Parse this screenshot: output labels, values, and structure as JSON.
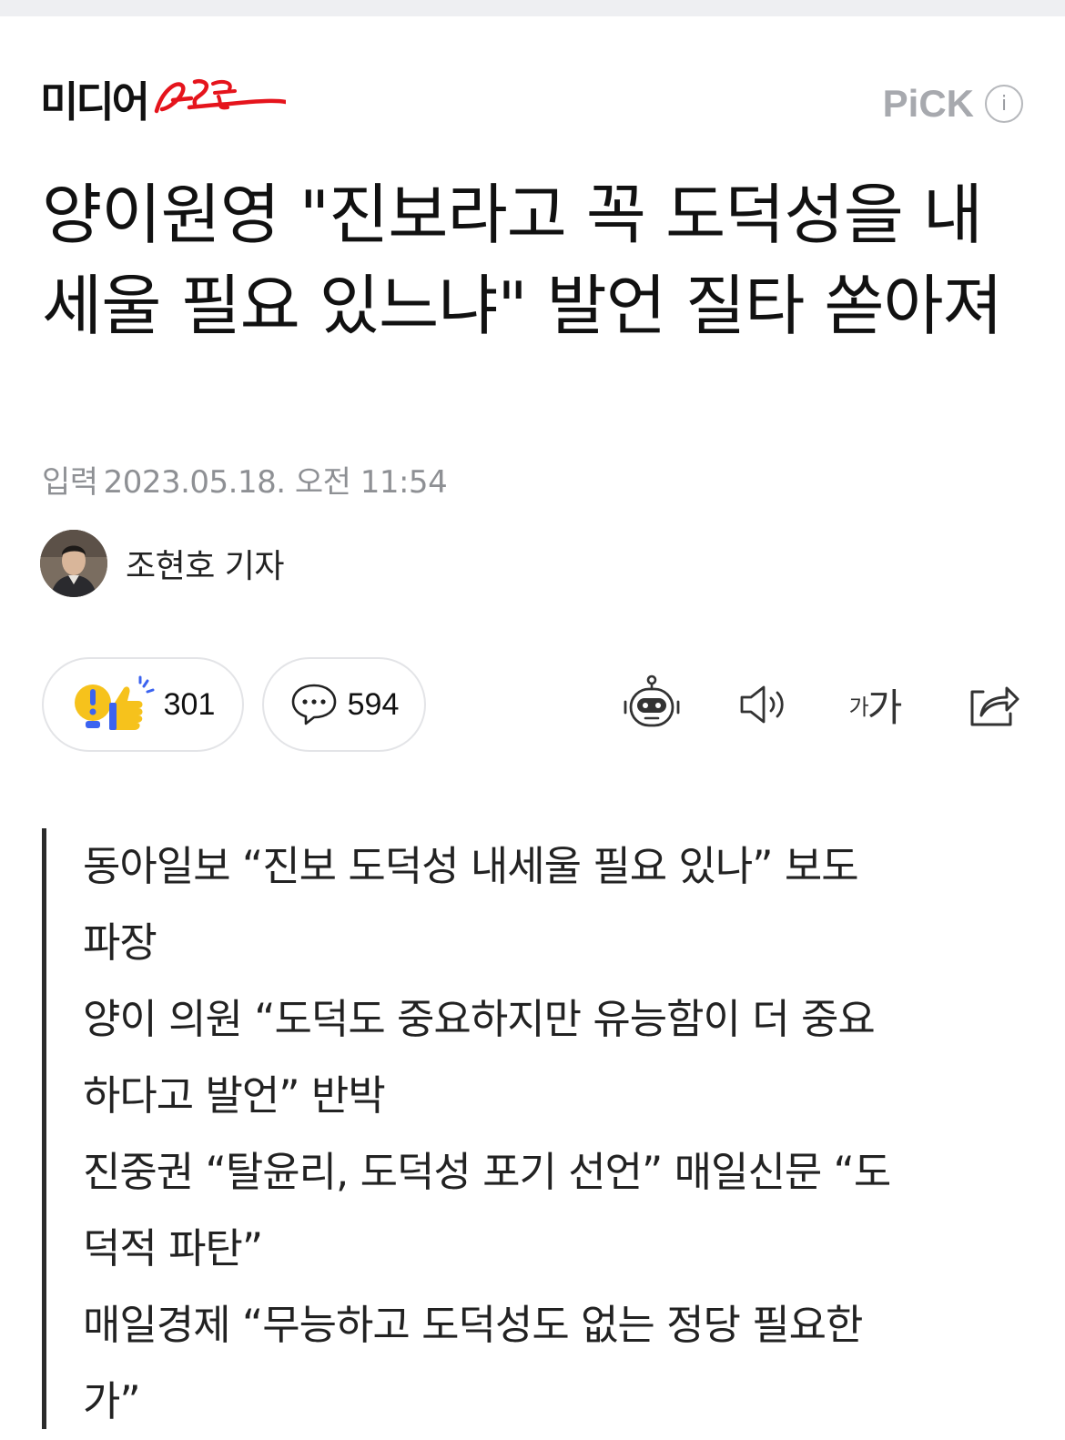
{
  "header": {
    "publisher": "미디어",
    "publisher_script": "오늘",
    "pick_label": "PiCK",
    "info_glyph": "i"
  },
  "article": {
    "headline": "양이원영 \"진보라고 꼭 도덕성을 내세울 필요 있느냐\" 발언 질타 쏟아져",
    "date_label": "입력",
    "date_value": "2023.05.18. 오전 11:54",
    "reporter": "조현호 기자"
  },
  "actions": {
    "reaction_count": "301",
    "comment_count": "594",
    "font_small": "가",
    "font_large": "가"
  },
  "icons": {
    "reaction": "reaction-emoji-icon",
    "comment": "comment-bubble-icon",
    "ai_summary": "robot-icon",
    "tts": "speaker-icon",
    "font_size": "font-size-icon",
    "share": "share-icon"
  },
  "colors": {
    "text": "#111111",
    "muted": "#8e9094",
    "pick_gray": "#a7a9ae",
    "logo_red": "#e5141c",
    "pill_border": "#e3e4e7",
    "reaction_yellow": "#f6c21c",
    "reaction_blue": "#3b63f0"
  },
  "summary": [
    "동아일보 “진보 도덕성 내세울 필요 있나” 보도",
    "파장",
    "양이 의원 “도덕도 중요하지만 유능함이 더 중요",
    "하다고 발언” 반박",
    "진중권 “탈윤리, 도덕성 포기 선언” 매일신문 “도",
    "덕적 파탄”",
    "매일경제 “무능하고 도덕성도 없는 정당 필요한",
    "가”"
  ]
}
